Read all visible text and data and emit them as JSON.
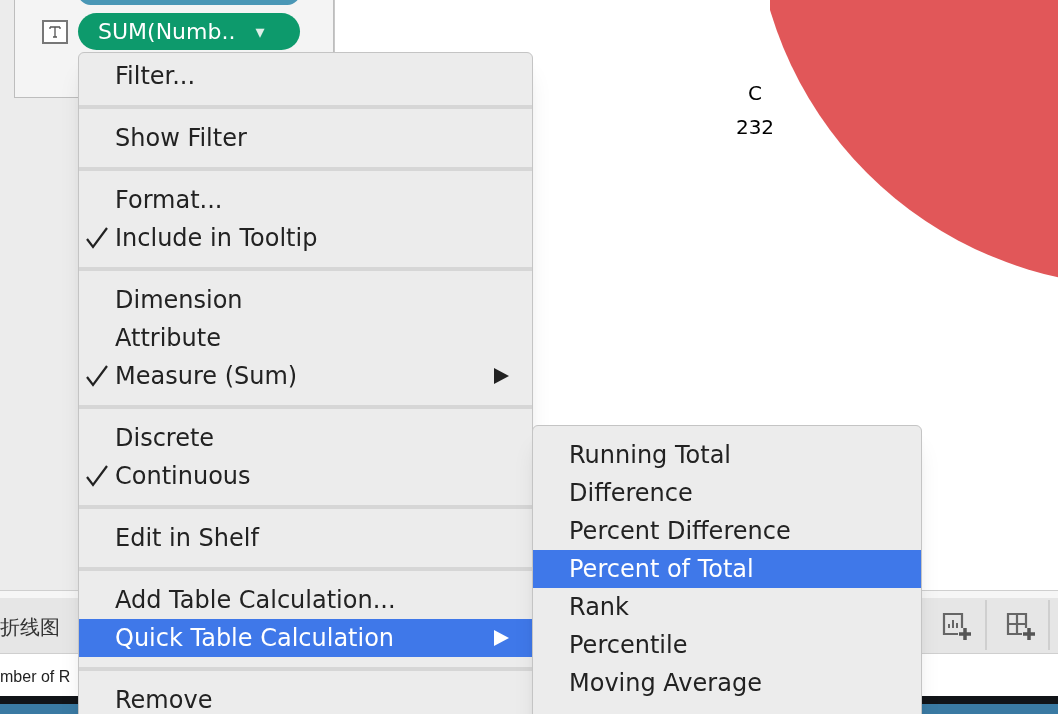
{
  "shelf": {
    "pill": {
      "label": "SUM(Numb..",
      "caret": "▾"
    }
  },
  "view": {
    "label_name": "C",
    "label_value": "232"
  },
  "sheet_tab": {
    "label": "折线图"
  },
  "status_text": "mber of R",
  "context_menu": {
    "sections": [
      [
        {
          "label": "Filter...",
          "checked": false,
          "submenu": false,
          "selected": false
        }
      ],
      [
        {
          "label": "Show Filter",
          "checked": false,
          "submenu": false,
          "selected": false
        }
      ],
      [
        {
          "label": "Format...",
          "checked": false,
          "submenu": false,
          "selected": false
        },
        {
          "label": "Include in Tooltip",
          "checked": true,
          "submenu": false,
          "selected": false
        }
      ],
      [
        {
          "label": "Dimension",
          "checked": false,
          "submenu": false,
          "selected": false
        },
        {
          "label": "Attribute",
          "checked": false,
          "submenu": false,
          "selected": false
        },
        {
          "label": "Measure (Sum)",
          "checked": true,
          "submenu": true,
          "selected": false
        }
      ],
      [
        {
          "label": "Discrete",
          "checked": false,
          "submenu": false,
          "selected": false
        },
        {
          "label": "Continuous",
          "checked": true,
          "submenu": false,
          "selected": false
        }
      ],
      [
        {
          "label": "Edit in Shelf",
          "checked": false,
          "submenu": false,
          "selected": false
        }
      ],
      [
        {
          "label": "Add Table Calculation...",
          "checked": false,
          "submenu": false,
          "selected": false
        },
        {
          "label": "Quick Table Calculation",
          "checked": false,
          "submenu": true,
          "selected": true
        }
      ],
      [
        {
          "label": "Remove",
          "checked": false,
          "submenu": false,
          "selected": false
        }
      ]
    ]
  },
  "submenu": {
    "items": [
      {
        "label": "Running Total",
        "selected": false
      },
      {
        "label": "Difference",
        "selected": false
      },
      {
        "label": "Percent Difference",
        "selected": false
      },
      {
        "label": "Percent of Total",
        "selected": true
      },
      {
        "label": "Rank",
        "selected": false
      },
      {
        "label": "Percentile",
        "selected": false
      },
      {
        "label": "Moving Average",
        "selected": false
      }
    ]
  }
}
